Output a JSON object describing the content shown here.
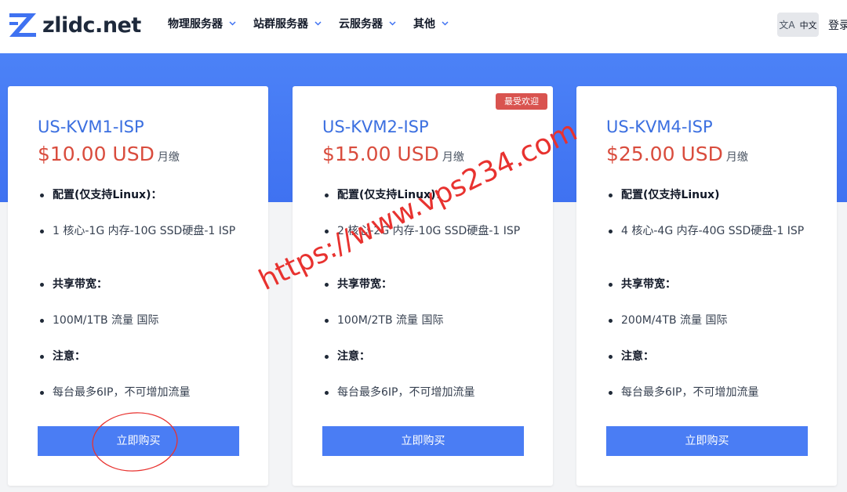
{
  "header": {
    "logo_text": "zlidc.net",
    "nav": [
      {
        "label": "物理服务器",
        "icon": "chevron-down-icon"
      },
      {
        "label": "站群服务器",
        "icon": "chevron-down-icon"
      },
      {
        "label": "云服务器",
        "icon": "chevron-down-icon"
      },
      {
        "label": "其他",
        "icon": "chevron-down-icon"
      }
    ],
    "lang_icon": "translate-icon",
    "lang_glyph": "文A",
    "lang_label": "中文",
    "login_label": "登录"
  },
  "colors": {
    "accent": "#3f72f1",
    "button": "#4a7df4",
    "title": "#3b6fe0",
    "price": "#d94c3d",
    "badge": "#d9534f",
    "annotation": "#e8322f"
  },
  "cards": [
    {
      "title": "US-KVM1-ISP",
      "price": "$10.00 USD",
      "period": "月缴",
      "badge": "",
      "features": [
        "配置(仅支持Linux)：",
        "1 核心-1G 内存-10G SSD硬盘-1 ISP",
        "共享带宽：",
        "100M/1TB 流量 国际",
        "注意：",
        "每台最多6IP，不可增加流量"
      ],
      "button": "立即购买"
    },
    {
      "title": "US-KVM2-ISP",
      "price": "$15.00 USD",
      "period": "月缴",
      "badge": "最受欢迎",
      "features": [
        "配置(仅支持Linux)：",
        "2 核心-2G 内存-10G SSD硬盘-1 ISP",
        "共享带宽：",
        "100M/2TB 流量 国际",
        "注意：",
        "每台最多6IP，不可增加流量"
      ],
      "button": "立即购买"
    },
    {
      "title": "US-KVM4-ISP",
      "price": "$25.00 USD",
      "period": "月缴",
      "badge": "",
      "features": [
        "配置(仅支持Linux)",
        "4 核心-4G 内存-40G SSD硬盘-1 ISP",
        "共享带宽：",
        "200M/4TB 流量 国际",
        "注意：",
        "每台最多6IP，不可增加流量"
      ],
      "button": "立即购买"
    }
  ],
  "watermark": "https://www.vps234.com"
}
